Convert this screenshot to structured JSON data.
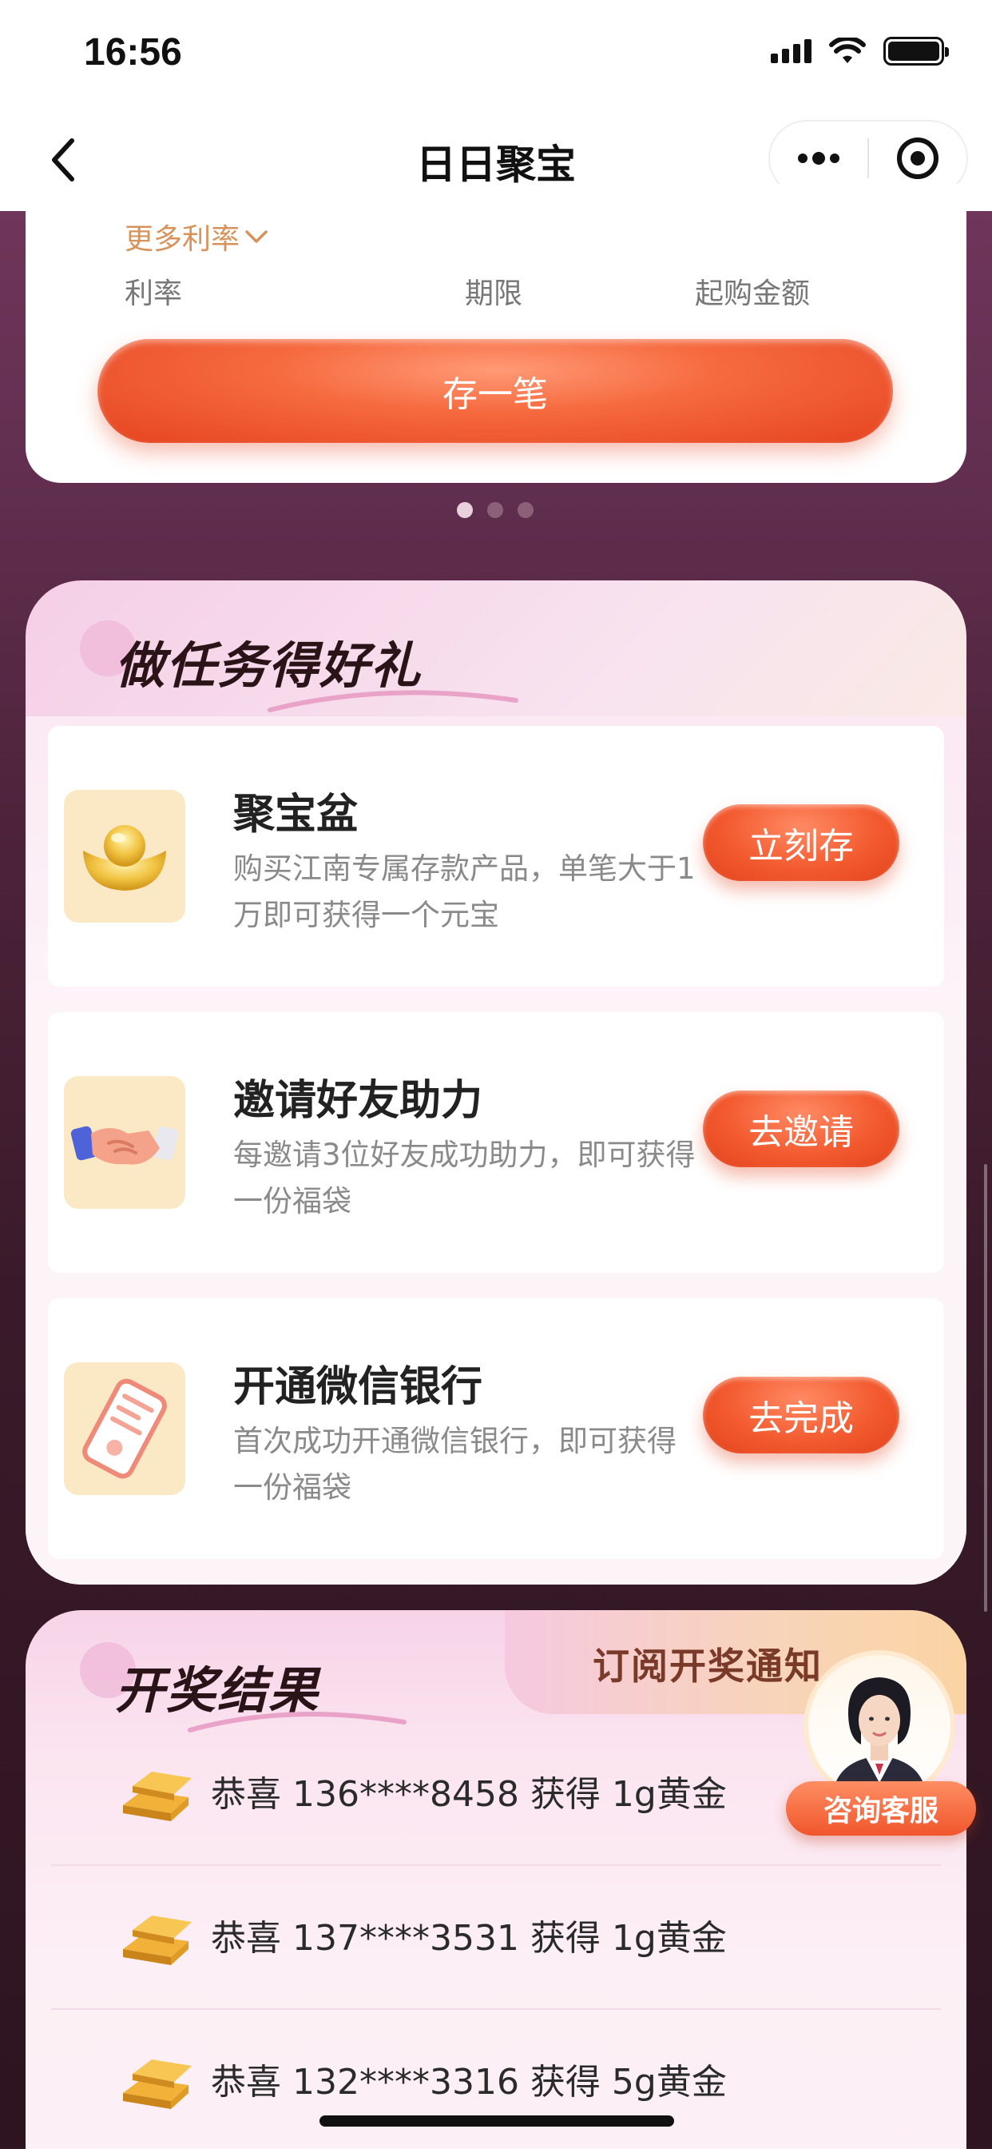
{
  "status_bar": {
    "time": "16:56"
  },
  "nav": {
    "title": "日日聚宝"
  },
  "top_card": {
    "more_rates": "更多利率",
    "headers": [
      "利率",
      "期限",
      "起购金额"
    ],
    "deposit_button": "存一笔"
  },
  "pager": {
    "total": 3,
    "active": 1
  },
  "tasks": {
    "title": "做任务得好礼",
    "items": [
      {
        "title": "聚宝盆",
        "desc": "购买江南专属存款产品，单笔大于1万即可获得一个元宝",
        "button": "立刻存",
        "icon": "gold-ingot-icon"
      },
      {
        "title": "邀请好友助力",
        "desc": "每邀请3位好友成功助力，即可获得一份福袋",
        "button": "去邀请",
        "icon": "handshake-icon"
      },
      {
        "title": "开通微信银行",
        "desc": "首次成功开通微信银行，即可获得一份福袋",
        "button": "去完成",
        "icon": "phone-card-icon"
      }
    ]
  },
  "results": {
    "title": "开奖结果",
    "subscribe": "订阅开奖通知",
    "winners": [
      {
        "text": "恭喜 136****8458 获得 1g黄金"
      },
      {
        "text": "恭喜 137****3531 获得 1g黄金"
      },
      {
        "text": "恭喜 132****3316 获得 5g黄金"
      }
    ]
  },
  "service": {
    "label": "咨询客服"
  },
  "colors": {
    "accent": "#f05a2c",
    "gold": "#e8a93a",
    "rate_link": "#d8935a"
  }
}
